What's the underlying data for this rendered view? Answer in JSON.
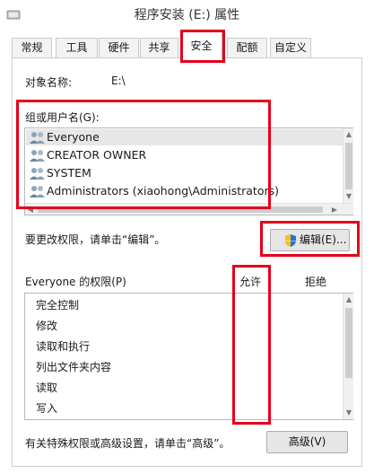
{
  "window": {
    "title": "程序安装 (E:) 属性"
  },
  "tabs": [
    {
      "label": "常规"
    },
    {
      "label": "工具"
    },
    {
      "label": "硬件"
    },
    {
      "label": "共享"
    },
    {
      "label": "安全"
    },
    {
      "label": "配额"
    },
    {
      "label": "自定义"
    }
  ],
  "security": {
    "object_name_label": "对象名称:",
    "object_name_value": "E:\\",
    "group_label": "组或用户名(G):",
    "users": [
      {
        "name": "Everyone"
      },
      {
        "name": "CREATOR OWNER"
      },
      {
        "name": "SYSTEM"
      },
      {
        "name": "Administrators (xiaohong\\Administrators)"
      }
    ],
    "change_hint": "要更改权限，请单击“编辑”。",
    "edit_button": "编辑(E)...",
    "permissions_label": "Everyone 的权限(P)",
    "allow_header": "允许",
    "deny_header": "拒绝",
    "permissions": [
      {
        "name": "完全控制"
      },
      {
        "name": "修改"
      },
      {
        "name": "读取和执行"
      },
      {
        "name": "列出文件夹内容"
      },
      {
        "name": "读取"
      },
      {
        "name": "写入"
      }
    ],
    "advanced_hint": "有关特殊权限或高级设置，请单击“高级”。",
    "advanced_button": "高级(V)"
  },
  "colors": {
    "highlight_red": "#e3001b",
    "selection": "#e7e7e7"
  }
}
